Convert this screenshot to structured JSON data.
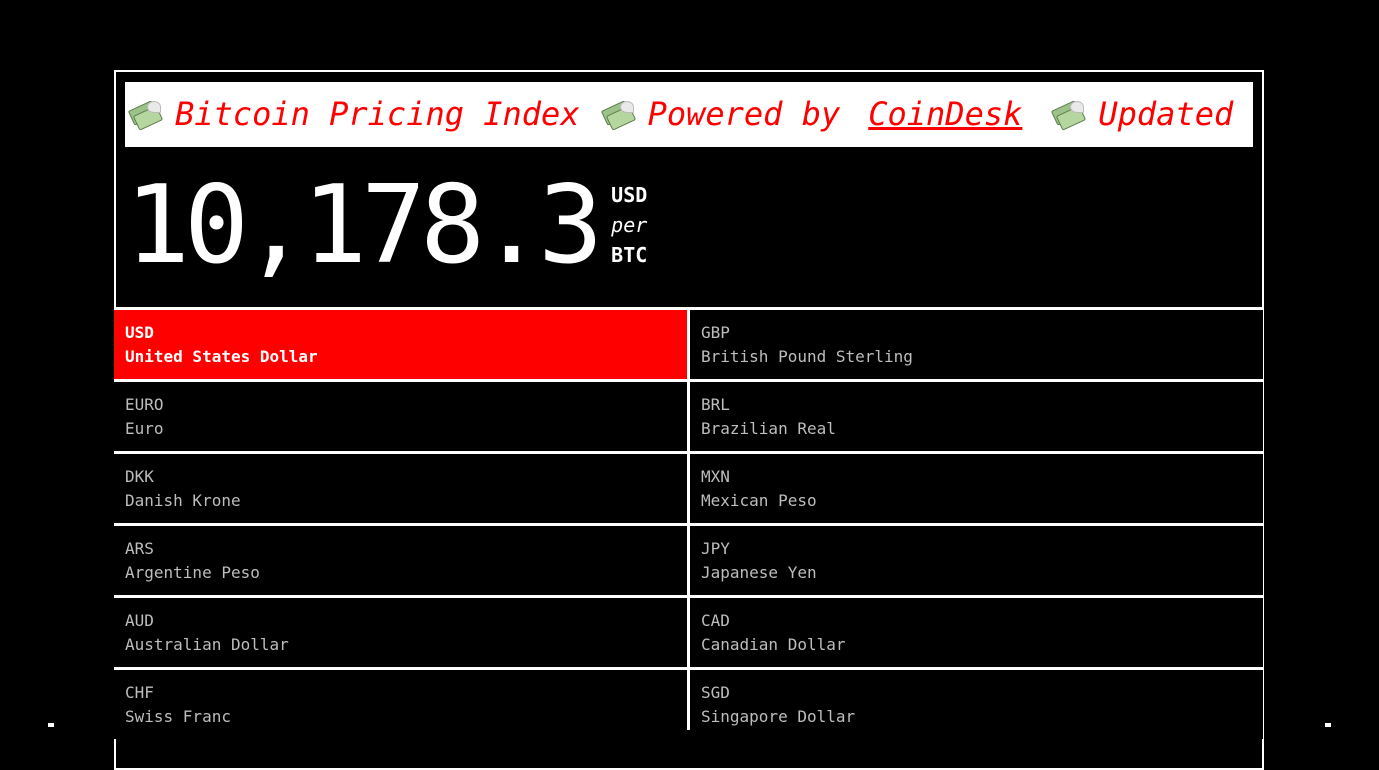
{
  "ticker": {
    "segments": [
      "Bitcoin Pricing Index",
      "Powered by",
      "CoinDesk",
      "Updated eve"
    ],
    "icon": "money-with-wings-icon"
  },
  "price": {
    "value": "10,178.3",
    "unit_top": "USD",
    "unit_mid": "per",
    "unit_bottom": "BTC"
  },
  "currencies": [
    {
      "code": "USD",
      "name": "United States Dollar",
      "selected": true
    },
    {
      "code": "GBP",
      "name": "British Pound Sterling",
      "selected": false
    },
    {
      "code": "EURO",
      "name": "Euro",
      "selected": false
    },
    {
      "code": "BRL",
      "name": "Brazilian Real",
      "selected": false
    },
    {
      "code": "DKK",
      "name": "Danish Krone",
      "selected": false
    },
    {
      "code": "MXN",
      "name": "Mexican Peso",
      "selected": false
    },
    {
      "code": "ARS",
      "name": "Argentine Peso",
      "selected": false
    },
    {
      "code": "JPY",
      "name": "Japanese Yen",
      "selected": false
    },
    {
      "code": "AUD",
      "name": "Australian Dollar",
      "selected": false
    },
    {
      "code": "CAD",
      "name": "Canadian Dollar",
      "selected": false
    },
    {
      "code": "CHF",
      "name": "Swiss Franc",
      "selected": false
    },
    {
      "code": "SGD",
      "name": "Singapore Dollar",
      "selected": false
    }
  ],
  "colors": {
    "background": "#000000",
    "accent": "#ff0000",
    "text": "#ffffff",
    "muted_text": "#bdbdbd"
  }
}
